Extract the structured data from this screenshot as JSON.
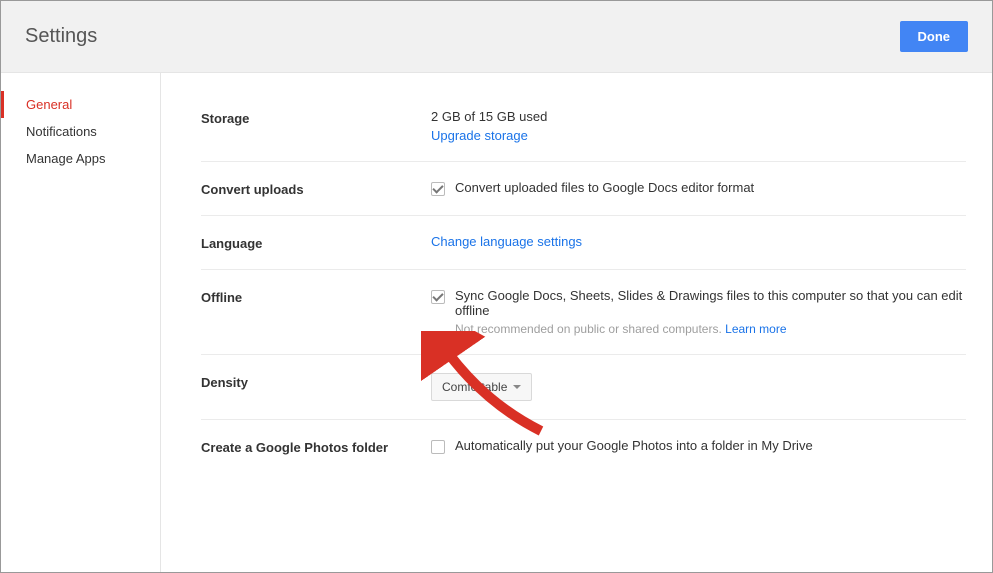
{
  "header": {
    "title": "Settings",
    "done_label": "Done"
  },
  "sidebar": {
    "items": [
      {
        "label": "General",
        "active": true
      },
      {
        "label": "Notifications",
        "active": false
      },
      {
        "label": "Manage Apps",
        "active": false
      }
    ]
  },
  "sections": {
    "storage": {
      "label": "Storage",
      "used_text": "2 GB of 15 GB used",
      "upgrade_link": "Upgrade storage"
    },
    "convert": {
      "label": "Convert uploads",
      "checkbox_label": "Convert uploaded files to Google Docs editor format",
      "checked": true
    },
    "language": {
      "label": "Language",
      "link_text": "Change language settings"
    },
    "offline": {
      "label": "Offline",
      "checkbox_label": "Sync Google Docs, Sheets, Slides & Drawings files to this computer so that you can edit offline",
      "checked": true,
      "subtext_prefix": "Not recommended on public or shared computers. ",
      "learn_more": "Learn more"
    },
    "density": {
      "label": "Density",
      "value": "Comfortable"
    },
    "photos": {
      "label": "Create a Google Photos folder",
      "checkbox_label": "Automatically put your Google Photos into a folder in My Drive",
      "checked": false
    }
  }
}
